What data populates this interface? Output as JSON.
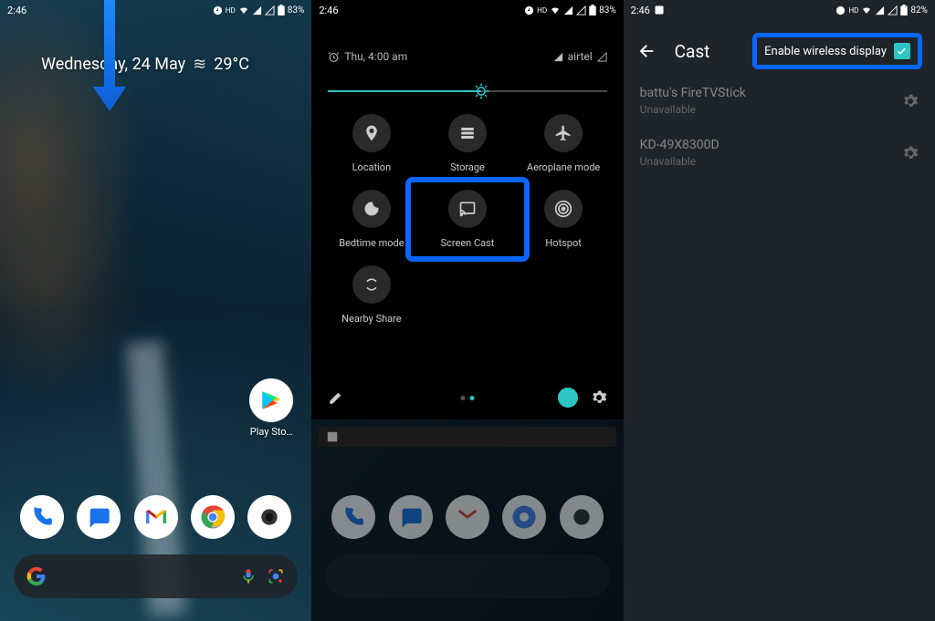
{
  "status": {
    "time": "2:46",
    "battery1": "83%",
    "battery2": "82%",
    "icons_text": "HD",
    "photo_icon": "▢"
  },
  "home": {
    "date": "Wednesday, 24 May",
    "weather_icon": "≋",
    "temp": "29°C",
    "play_store_label": "Play Sto…"
  },
  "qs": {
    "alarm_text": "Thu, 4:00 am",
    "carrier": "airtel",
    "tiles": [
      {
        "label": "Location"
      },
      {
        "label": "Storage"
      },
      {
        "label": "Aeroplane mode"
      },
      {
        "label": "Bedtime mode"
      },
      {
        "label": "Screen Cast"
      },
      {
        "label": "Hotspot"
      },
      {
        "label": "Nearby Share"
      }
    ]
  },
  "cast": {
    "title": "Cast",
    "enable_label": "Enable wireless display",
    "devices": [
      {
        "name": "battu's FireTVStick",
        "status": "Unavailable"
      },
      {
        "name": "KD-49X8300D",
        "status": "Unavailable"
      }
    ]
  }
}
